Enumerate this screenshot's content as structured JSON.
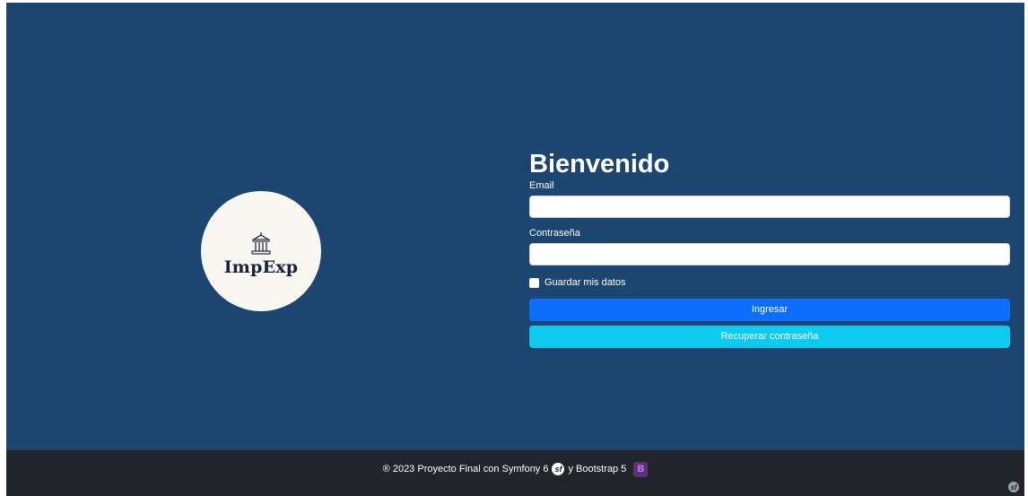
{
  "logo": {
    "text": "ImpExp",
    "icon": "building-columns-icon"
  },
  "login": {
    "title": "Bienvenido",
    "email_label": "Email",
    "email_value": "",
    "password_label": "Contraseña",
    "password_value": "",
    "remember_label": "Guardar mis datos",
    "remember_checked": false,
    "submit_label": "Ingresar",
    "recover_label": "Recuperar contraseña"
  },
  "footer": {
    "text_before": "® 2023 Proyecto Final con Symfony 6",
    "text_mid": "y Bootstrap 5",
    "symfony_icon": "symfony-logo-icon",
    "symfony_glyph": "sf",
    "bootstrap_icon": "bootstrap-logo-icon",
    "bootstrap_glyph": "B"
  },
  "colors": {
    "background": "#1c4670",
    "primary": "#0d6efd",
    "info": "#0dcaf0",
    "footer": "#212529",
    "logo_bg": "#f7f6ef"
  }
}
